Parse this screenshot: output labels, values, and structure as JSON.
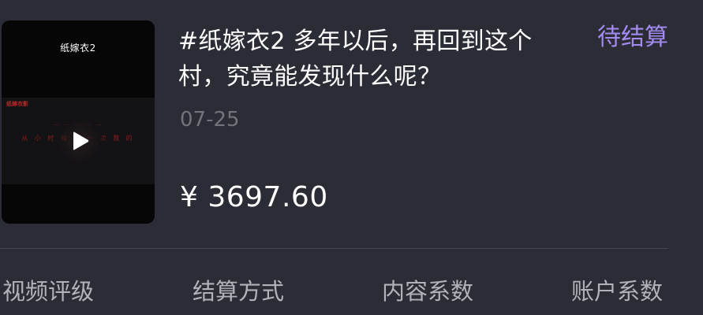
{
  "video": {
    "thumbnail_title": "纸嫁衣2",
    "thumbnail_mark": "纸嫁衣影",
    "thumbnail_subtitle_top": "一 一 一 一 一",
    "thumbnail_subtitle": "从 小 时 候 那 一 次 我 的",
    "title": "#纸嫁衣2 多年以后，再回到这个村，究竟能发现什么呢？",
    "date": "07-25",
    "amount": "¥ 3697.60",
    "status": "待结算",
    "play_icon": "play-icon"
  },
  "metrics": {
    "labels": [
      "视频评级",
      "结算方式",
      "内容系数",
      "账户系数"
    ]
  },
  "colors": {
    "background": "#2b2c35",
    "status_accent": "#a48bf2",
    "date_text": "#72737b",
    "label_text": "#b2b3ba"
  }
}
